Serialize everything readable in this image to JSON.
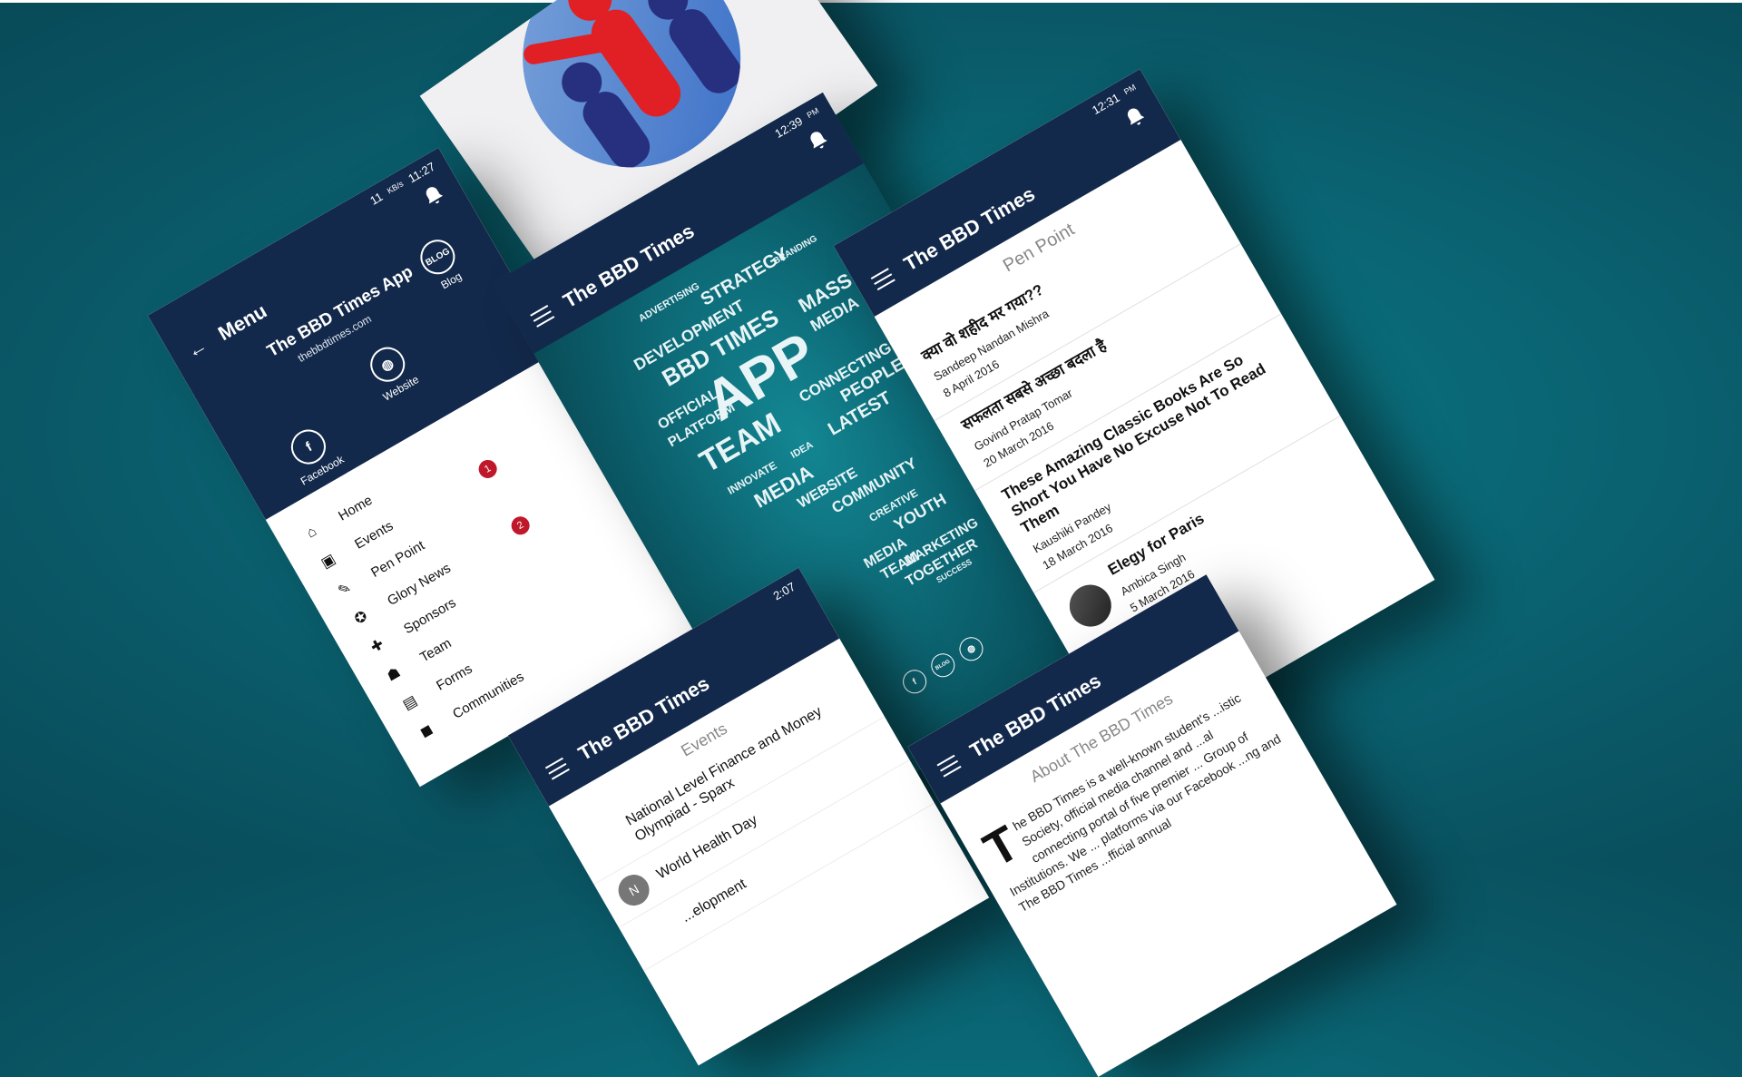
{
  "logo": {
    "alt_icon": "people-team-logo"
  },
  "menu_phone": {
    "status": {
      "speed_value": "11",
      "speed_unit": "KB/s",
      "time": "11:27"
    },
    "title": "Menu",
    "app_name": "The BBD Times App",
    "app_url": "thebbdtimes.com",
    "social": [
      {
        "label": "Blog",
        "icon": "BLOG"
      },
      {
        "label": "Website",
        "icon": "◍"
      },
      {
        "label": "Facebook",
        "icon": "f"
      }
    ],
    "items": [
      {
        "label": "Home",
        "icon": "⌂",
        "badge": ""
      },
      {
        "label": "Events",
        "icon": "▣",
        "badge": "1"
      },
      {
        "label": "Pen Point",
        "icon": "✎",
        "badge": ""
      },
      {
        "label": "Glory News",
        "icon": "✪",
        "badge": "2"
      },
      {
        "label": "Sponsors",
        "icon": "✚",
        "badge": ""
      },
      {
        "label": "Team",
        "icon": "☗",
        "badge": ""
      },
      {
        "label": "Forms",
        "icon": "▤",
        "badge": ""
      },
      {
        "label": "Communities",
        "icon": "◼",
        "badge": ""
      }
    ]
  },
  "splash_phone": {
    "status_time": "12:39",
    "status_ampm": "PM",
    "title": "The BBD Times",
    "cloud_words": {
      "w1": "ADVERTISING",
      "w2": "STRATEGY",
      "w3": "BRANDING",
      "w4": "DEVELOPMENT",
      "w5": "BBD TIMES",
      "w6": "APP",
      "w7": "MASS",
      "w8": "MEDIA",
      "w9": "OFFICIAL",
      "w10": "PLATFORM",
      "w11": "TEAM",
      "w12": "CONNECTING",
      "w13": "PEOPLE",
      "w14": "LATEST",
      "w15": "INNOVATE",
      "w16": "IDEA",
      "w17": "MEDIA",
      "w18": "WEBSITE",
      "w19": "COMMUNITY",
      "w20": "CREATIVE",
      "w21": "YOUTH",
      "w22": "MEDIA",
      "w23": "TEAM",
      "w24": "MARKETING",
      "w25": "TOGETHER",
      "w26": "SUCCESS"
    },
    "bottom_icons": [
      "f",
      "BLOG",
      "◍"
    ]
  },
  "pen_phone": {
    "status_time": "12:31",
    "status_ampm": "PM",
    "title": "The BBD Times",
    "section_title": "Pen Point",
    "articles": [
      {
        "headline": "क्या वो शहीद मर गया??",
        "author": "Sandeep Nandan Mishra",
        "date": "8 April 2016"
      },
      {
        "headline": "सफलता सबसे अच्छा बदला है",
        "author": "Govind Pratap Tomar",
        "date": "20 March 2016"
      },
      {
        "headline": "These Amazing Classic Books Are So Short You Have No Excuse Not To Read Them",
        "author": "Kaushiki Pandey",
        "date": "18 March 2016"
      },
      {
        "headline": "Elegy for Paris",
        "author": "Ambica Singh",
        "date": "5 March 2016"
      }
    ]
  },
  "events_phone": {
    "status_time": "2:07",
    "title": "The BBD Times",
    "section_title": "Events",
    "events": [
      {
        "letter": "",
        "text": "National Level Finance and Money Olympiad - Sparx"
      },
      {
        "letter": "N",
        "text": "World Health Day"
      },
      {
        "letter": "",
        "text": "...elopment"
      }
    ]
  },
  "about_phone": {
    "title": "The BBD Times",
    "section_title": "About The BBD Times",
    "dropcap": "T",
    "body": "he BBD Times is a well-known student's ...istic Society, official media channel and ...al connecting portal of five premier ... Group of Institutions. We ... platforms via our Facebook ...ng and The BBD Times ...fficial annual"
  }
}
